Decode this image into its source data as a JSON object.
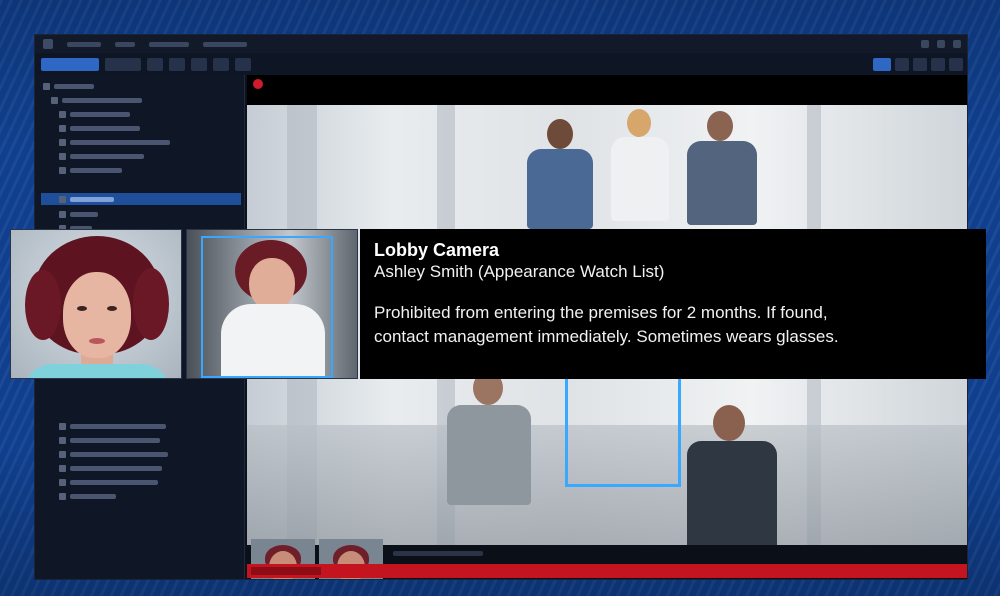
{
  "alert": {
    "camera_name": "Lobby Camera",
    "person_line": "Ashley Smith (Appearance Watch List)",
    "note_line1": "Prohibited from entering the premises for 2 months. If found,",
    "note_line2": "contact management immediately. Sometimes wears glasses."
  },
  "colors": {
    "background_blue": "#0f3f8e",
    "detection_box": "#39a8ff",
    "alert_red": "#c4141f",
    "toolbar_active": "#2e67c4"
  }
}
